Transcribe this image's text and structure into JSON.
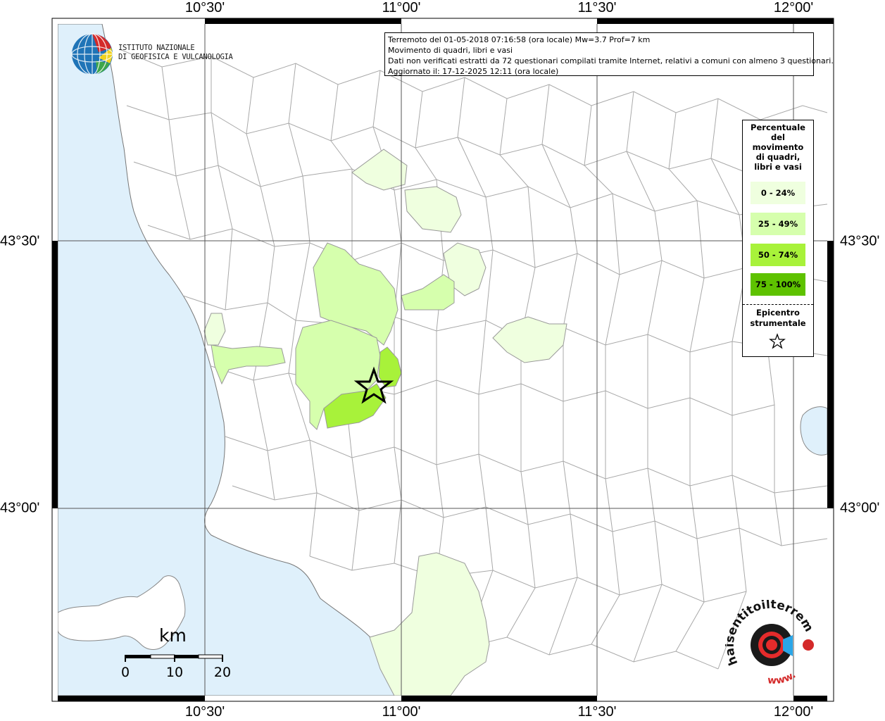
{
  "axes": {
    "top_labels": [
      "10°30'",
      "11°00'",
      "11°30'",
      "12°00'"
    ],
    "bottom_labels": [
      "10°30'",
      "11°00'",
      "11°30'",
      "12°00'"
    ],
    "left_labels": [
      "43°30'",
      "43°00'"
    ],
    "right_labels": [
      "43°30'",
      "43°00'"
    ]
  },
  "info": {
    "line1": "Terremoto del 01-05-2018 07:16:58 (ora locale) Mw=3.7 Prof=7 km",
    "line2": "Movimento di quadri, libri e vasi",
    "line3": "Dati non verificati estratti da 72 questionari compilati tramite Internet, relativi a comuni con almeno 3 questionari.",
    "line4": "Aggiornato il: 17-12-2025 12:11 (ora locale)"
  },
  "legend": {
    "title_lines": [
      "Percentuale",
      "del",
      "movimento",
      "di quadri,",
      "libri e vasi"
    ],
    "classes": [
      {
        "label": "0 - 24%",
        "color": "#efffdf"
      },
      {
        "label": "25 - 49%",
        "color": "#d6ffad"
      },
      {
        "label": "50 - 74%",
        "color": "#a8f23a"
      },
      {
        "label": "75 - 100%",
        "color": "#5ec200"
      }
    ],
    "epicenter_lines": [
      "Epicentro",
      "strumentale"
    ]
  },
  "logos": {
    "ingv_line1": "ISTITUTO NAZIONALE",
    "ingv_line2": "DI GEOFISICA E VULCANOLOGIA",
    "hst_text": "haisentitoilterremoto.it",
    "hst_www": "www."
  },
  "scale": {
    "unit": "km",
    "ticks": [
      "0",
      "10",
      "20"
    ]
  },
  "colors": {
    "sea": "#dff0fb",
    "land": "#ffffff",
    "border": "#a8a8a8",
    "grid": "#555555"
  }
}
